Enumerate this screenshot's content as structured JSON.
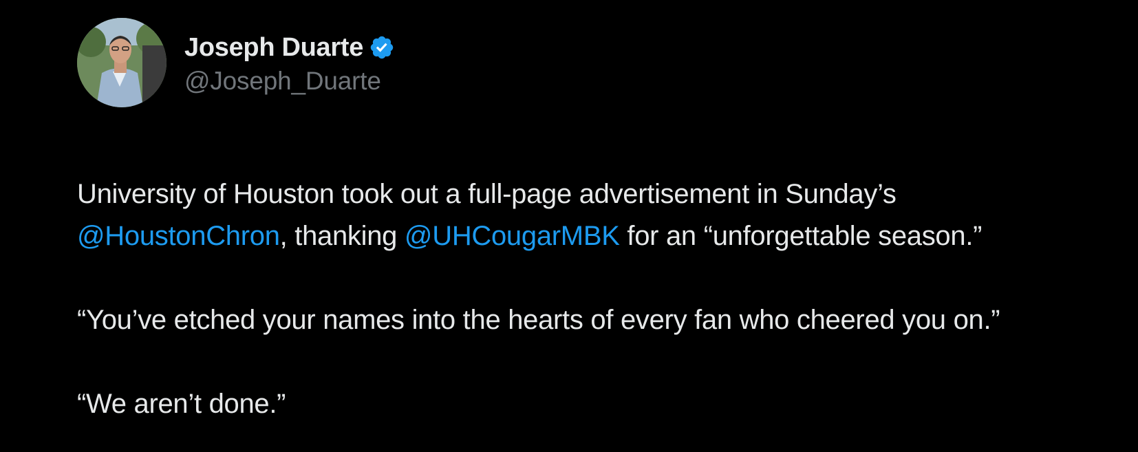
{
  "author": {
    "display_name": "Joseph Duarte",
    "handle": "@Joseph_Duarte",
    "verified_icon": "verified-badge-icon"
  },
  "tweet": {
    "p1_text_1": "University of Houston took out a full-page advertisement in Sunday’s",
    "p1_mention_1": "@HoustonChron",
    "p1_text_2": ", thanking ",
    "p1_mention_2": "@UHCougarMBK",
    "p1_text_3": " for an “unforgettable season.”",
    "p2": "“You’ve etched your names into the hearts of every fan who cheered you on.”",
    "p3": "“We aren’t done.”"
  },
  "colors": {
    "background": "#000000",
    "text": "#e7e9ea",
    "secondary": "#71767b",
    "accent": "#1d9bf0"
  }
}
